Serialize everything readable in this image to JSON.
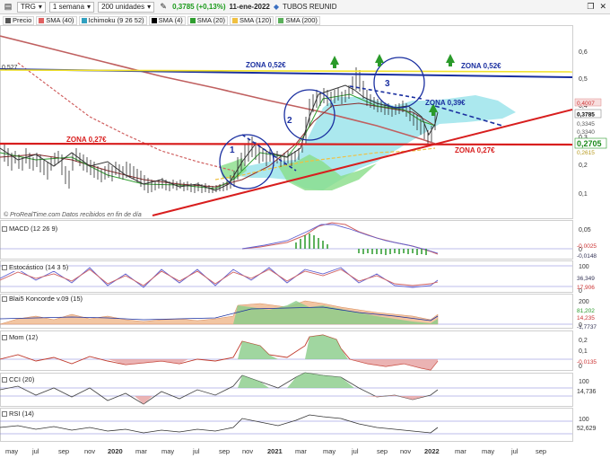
{
  "toolbar": {
    "symbol": "TRG",
    "period": "1 semana",
    "units": "200 unidades",
    "price_change": "0,3785 (+0,13%)",
    "date": "11-ene-2022",
    "company": "TUBOS REUNID"
  },
  "legend": [
    {
      "label": "Precio",
      "color": "#555555"
    },
    {
      "label": "SMA (40)",
      "color": "#e06060"
    },
    {
      "label": "Ichimoku (9 26 52)",
      "color": "#30a0c0"
    },
    {
      "label": "SMA (4)",
      "color": "#000000"
    },
    {
      "label": "SMA (20)",
      "color": "#2f9e2f"
    },
    {
      "label": "SMA (120)",
      "color": "#f0c040"
    },
    {
      "label": "SMA (200)",
      "color": "#5ab05a"
    }
  ],
  "main": {
    "top_left_value": "0,527",
    "watermark": "© ProRealTime.com  Datos recibidos en fin de día",
    "annotations": {
      "zona_052_left": "ZONA 0,52€",
      "zona_052_right": "ZONA 0,52€",
      "zona_039": "ZONA 0,39€",
      "zona_027_left": "ZONA 0,27€",
      "zona_027_right": "ZONA 0,27€",
      "wave1": "1",
      "wave2": "2",
      "wave3": "3"
    },
    "y_axis": [
      "0,6",
      "0,5",
      "0,4",
      "0,3",
      "0,2",
      "0,1"
    ],
    "price_tags": [
      "0,4007",
      "0,3785",
      "0,3345",
      "0,3340",
      "0,2705",
      "0,2615"
    ]
  },
  "indicators": {
    "macd": {
      "label": "MACD (12 26 9)",
      "axis": [
        "0,05",
        "0"
      ],
      "tags": [
        "-0,0025",
        "-0,0148"
      ]
    },
    "stoch": {
      "label": "Estocástico (14 3 5)",
      "axis": [
        "100",
        "0"
      ],
      "tags": [
        "36,349",
        "17,906"
      ]
    },
    "blai5": {
      "label": "Blai5 Koncorde v.09 (15)",
      "axis": [
        "200",
        "0"
      ],
      "tags": [
        "81,202",
        "14,235",
        "-1,7737"
      ]
    },
    "mom": {
      "label": "Mom (12)",
      "axis": [
        "0,2",
        "0,1",
        "0"
      ],
      "tags": [
        "-0,0135"
      ]
    },
    "cci": {
      "label": "CCI (20)",
      "axis": [
        "100"
      ],
      "tags": [
        "14,736"
      ]
    },
    "rsi": {
      "label": "RSI (14)",
      "axis": [
        "100"
      ],
      "tags": [
        "52,629"
      ]
    }
  },
  "x_axis": [
    "may",
    "jul",
    "sep",
    "nov",
    "2020",
    "mar",
    "may",
    "jul",
    "sep",
    "nov",
    "2021",
    "mar",
    "may",
    "jul",
    "sep",
    "nov",
    "2022",
    "mar",
    "may",
    "jul",
    "sep"
  ],
  "colors": {
    "blue_line": "#1a2fa0",
    "red_line": "#d81e1e",
    "yellow_line": "#f2e22a",
    "cloud": "#8fe0e8",
    "cloud_green": "#88dd88",
    "up": "#2a9a2a"
  }
}
